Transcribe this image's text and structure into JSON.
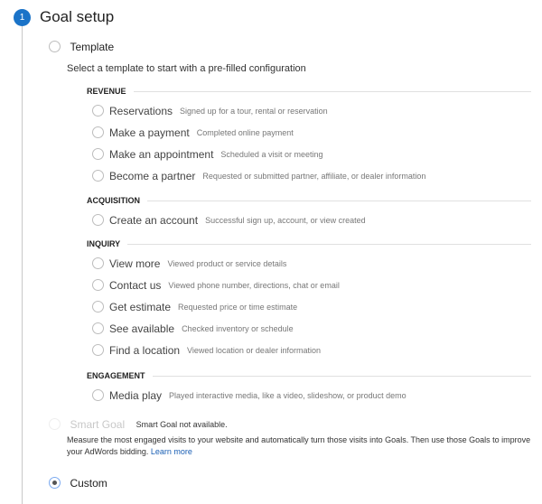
{
  "step": {
    "number": "1",
    "title": "Goal setup"
  },
  "template": {
    "label": "Template",
    "description": "Select a template to start with a pre-filled configuration",
    "categories": [
      {
        "name": "REVENUE",
        "items": [
          {
            "name": "Reservations",
            "desc": "Signed up for a tour, rental or reservation"
          },
          {
            "name": "Make a payment",
            "desc": "Completed online payment"
          },
          {
            "name": "Make an appointment",
            "desc": "Scheduled a visit or meeting"
          },
          {
            "name": "Become a partner",
            "desc": "Requested or submitted partner, affiliate, or dealer information"
          }
        ]
      },
      {
        "name": "ACQUISITION",
        "items": [
          {
            "name": "Create an account",
            "desc": "Successful sign up, account, or view created"
          }
        ]
      },
      {
        "name": "INQUIRY",
        "items": [
          {
            "name": "View more",
            "desc": "Viewed product or service details"
          },
          {
            "name": "Contact us",
            "desc": "Viewed phone number, directions, chat or email"
          },
          {
            "name": "Get estimate",
            "desc": "Requested price or time estimate"
          },
          {
            "name": "See available",
            "desc": "Checked inventory or schedule"
          },
          {
            "name": "Find a location",
            "desc": "Viewed location or dealer information"
          }
        ]
      },
      {
        "name": "ENGAGEMENT",
        "items": [
          {
            "name": "Media play",
            "desc": "Played interactive media, like a video, slideshow, or product demo"
          }
        ]
      }
    ]
  },
  "smart_goal": {
    "label": "Smart Goal",
    "note": "Smart Goal not available.",
    "description": "Measure the most engaged visits to your website and automatically turn those visits into Goals. Then use those Goals to improve your AdWords bidding.",
    "link": "Learn more"
  },
  "custom": {
    "label": "Custom",
    "selected": true
  },
  "colors": {
    "accent": "#1a73c8",
    "link": "#1a5fb4"
  }
}
